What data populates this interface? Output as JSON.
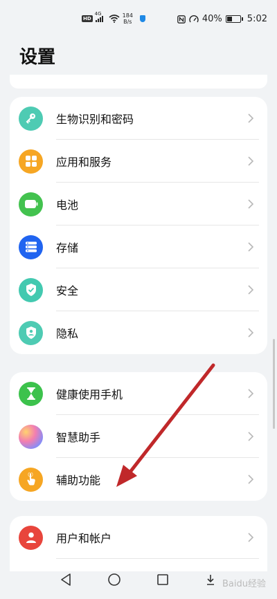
{
  "status_bar": {
    "network_badge": "HD",
    "net_type": "4G",
    "speed_value": "184",
    "speed_unit": "B/s",
    "battery_percent": "40%",
    "battery_level": 0.4,
    "time": "5:02"
  },
  "page_title": "设置",
  "groups": [
    {
      "items": [
        {
          "label": "生物识别和密码",
          "icon": "key-icon",
          "color": "#4ecbb3"
        },
        {
          "label": "应用和服务",
          "icon": "apps-grid-icon",
          "color": "#f6a623"
        },
        {
          "label": "电池",
          "icon": "battery-icon",
          "color": "#43c24f"
        },
        {
          "label": "存储",
          "icon": "storage-icon",
          "color": "#2064f0"
        },
        {
          "label": "安全",
          "icon": "shield-check-icon",
          "color": "#43c9b0"
        },
        {
          "label": "隐私",
          "icon": "privacy-shield-icon",
          "color": "#4ecbb3"
        }
      ]
    },
    {
      "items": [
        {
          "label": "健康使用手机",
          "icon": "hourglass-icon",
          "color": "#3cc24c"
        },
        {
          "label": "智慧助手",
          "icon": "assistant-orb-icon",
          "color": "#b89df5"
        },
        {
          "label": "辅助功能",
          "icon": "hand-icon",
          "color": "#f6a623"
        }
      ]
    },
    {
      "items": [
        {
          "label": "用户和帐户",
          "icon": "user-icon",
          "color": "#e8453c"
        }
      ]
    }
  ],
  "watermark": "Baidu经验",
  "annotation_color": "#c0282a"
}
